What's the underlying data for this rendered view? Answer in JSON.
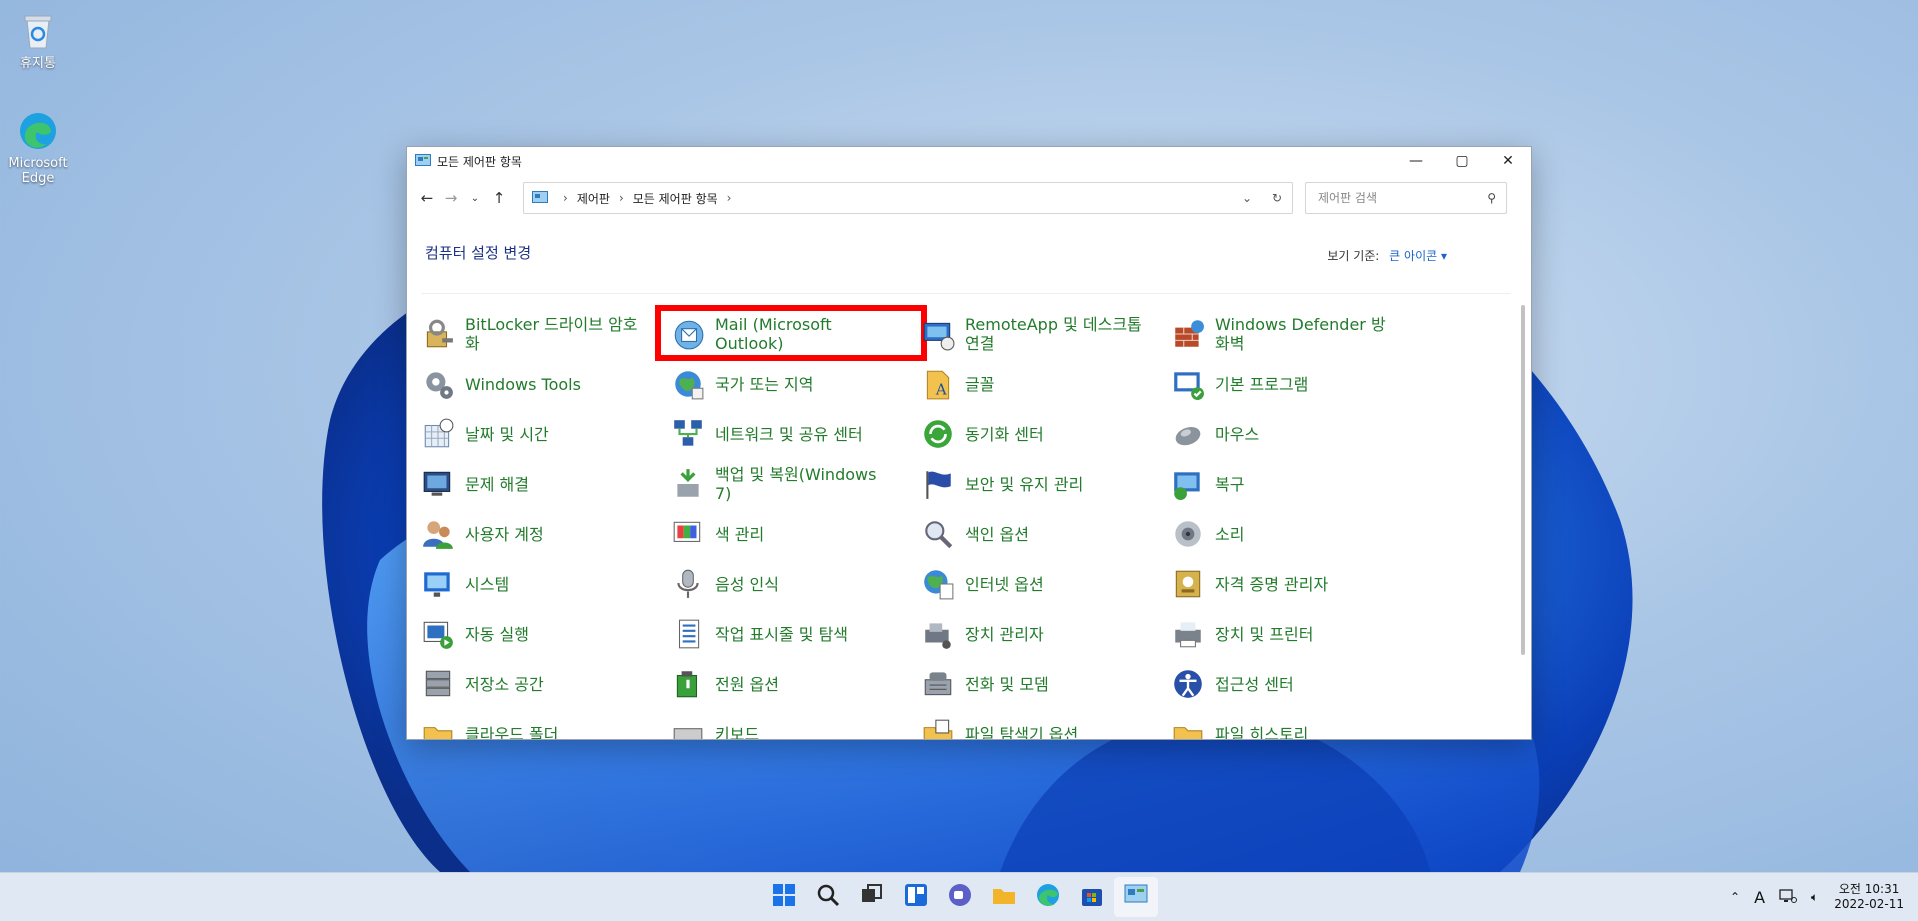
{
  "desktop": {
    "icons": [
      {
        "label": "휴지통",
        "icon": "recycle-bin-icon"
      },
      {
        "label": "Microsoft Edge",
        "icon": "edge-icon"
      }
    ]
  },
  "window": {
    "title": "모든 제어판 항목",
    "address": {
      "crumbs": [
        "제어판",
        "모든 제어판 항목"
      ]
    },
    "search_placeholder": "제어판 검색",
    "header_title": "컴퓨터 설정 변경",
    "view_by_label": "보기 기준:",
    "view_by_value": "큰 아이콘 ▾",
    "items": [
      {
        "label": "BitLocker 드라이브 암호화",
        "icon": "bitlocker-icon"
      },
      {
        "label": "Mail (Microsoft Outlook)",
        "icon": "mail-icon",
        "highlighted": true
      },
      {
        "label": "RemoteApp 및 데스크톱 연결",
        "icon": "remoteapp-icon"
      },
      {
        "label": "Windows Defender 방화벽",
        "icon": "firewall-icon"
      },
      {
        "label": "Windows Tools",
        "icon": "windows-tools-icon"
      },
      {
        "label": "국가 또는 지역",
        "icon": "region-icon"
      },
      {
        "label": "글꼴",
        "icon": "fonts-icon"
      },
      {
        "label": "기본 프로그램",
        "icon": "default-programs-icon"
      },
      {
        "label": "날짜 및 시간",
        "icon": "date-time-icon"
      },
      {
        "label": "네트워크 및 공유 센터",
        "icon": "network-icon"
      },
      {
        "label": "동기화 센터",
        "icon": "sync-center-icon"
      },
      {
        "label": "마우스",
        "icon": "mouse-icon"
      },
      {
        "label": "문제 해결",
        "icon": "troubleshoot-icon"
      },
      {
        "label": "백업 및 복원(Windows 7)",
        "icon": "backup-icon"
      },
      {
        "label": "보안 및 유지 관리",
        "icon": "security-flag-icon"
      },
      {
        "label": "복구",
        "icon": "recovery-icon"
      },
      {
        "label": "사용자 계정",
        "icon": "user-accounts-icon"
      },
      {
        "label": "색 관리",
        "icon": "color-management-icon"
      },
      {
        "label": "색인 옵션",
        "icon": "indexing-icon"
      },
      {
        "label": "소리",
        "icon": "sound-icon"
      },
      {
        "label": "시스템",
        "icon": "system-icon"
      },
      {
        "label": "음성 인식",
        "icon": "speech-icon"
      },
      {
        "label": "인터넷 옵션",
        "icon": "internet-options-icon"
      },
      {
        "label": "자격 증명 관리자",
        "icon": "credential-icon"
      },
      {
        "label": "자동 실행",
        "icon": "autoplay-icon"
      },
      {
        "label": "작업 표시줄 및 탐색",
        "icon": "taskbar-nav-icon"
      },
      {
        "label": "장치 관리자",
        "icon": "device-manager-icon"
      },
      {
        "label": "장치 및 프린터",
        "icon": "devices-printers-icon"
      },
      {
        "label": "저장소 공간",
        "icon": "storage-spaces-icon"
      },
      {
        "label": "전원 옵션",
        "icon": "power-icon"
      },
      {
        "label": "전화 및 모뎀",
        "icon": "phone-modem-icon"
      },
      {
        "label": "접근성 센터",
        "icon": "ease-of-access-icon"
      },
      {
        "label": "클라우드 폴더",
        "icon": "folder-icon"
      },
      {
        "label": "키보드",
        "icon": "keyboard-icon"
      },
      {
        "label": "파일 탐색기 옵션",
        "icon": "explorer-options-icon"
      },
      {
        "label": "파일 히스토리",
        "icon": "file-history-icon"
      }
    ]
  },
  "taskbar": {
    "apps": [
      "start-icon",
      "search-icon",
      "task-view-icon",
      "widgets-icon",
      "chat-icon",
      "file-explorer-icon",
      "edge-icon",
      "store-icon",
      "control-panel-icon"
    ],
    "tray": {
      "ime": "A",
      "time": "오전 10:31",
      "date": "2022-02-11"
    }
  },
  "colors": {
    "link_green": "#237b2c",
    "title_blue": "#1e3287",
    "highlight_red": "#ff0000"
  }
}
